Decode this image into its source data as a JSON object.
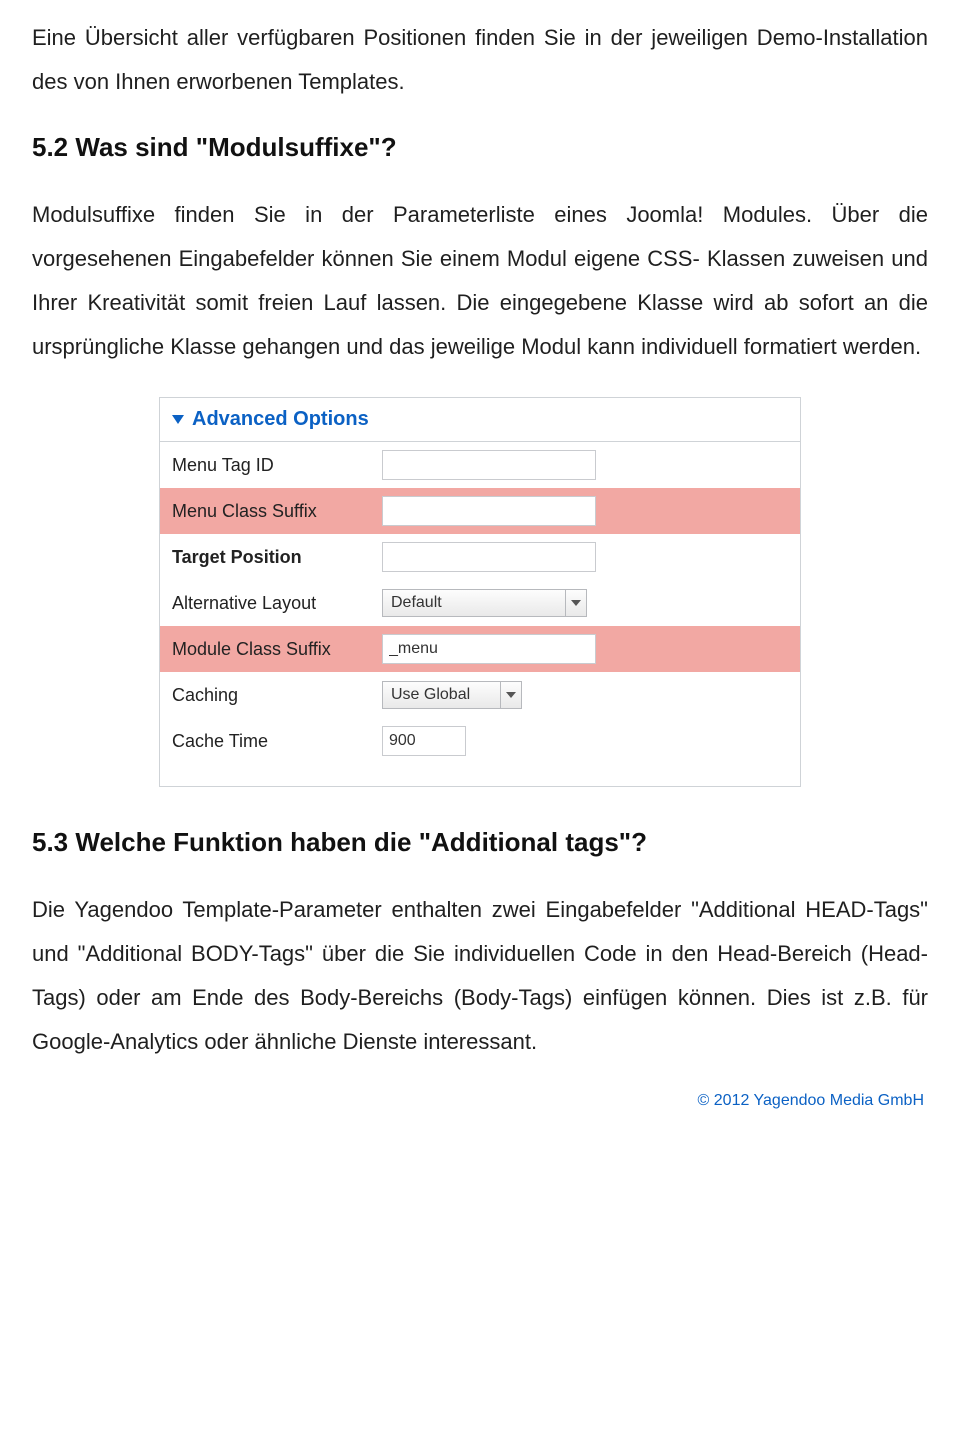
{
  "intro_paragraph": "Eine Übersicht aller verfügbaren Positionen finden Sie in der jeweiligen Demo-Installation des von Ihnen erworbenen Templates.",
  "heading_5_2": "5.2 Was sind \"Modulsuffixe\"?",
  "paragraph_5_2": "Modulsuffixe finden Sie in der Parameterliste eines Joomla! Modules. Über die vorgesehenen Eingabefelder können Sie einem Modul eigene CSS- Klassen zuweisen und Ihrer Kreativität somit freien Lauf lassen. Die eingegebene Klasse wird ab sofort an die  ursprüngliche Klasse gehangen und das jeweilige Modul kann individuell formatiert werden.",
  "panel": {
    "title": "Advanced Options",
    "rows": {
      "menu_tag_id": {
        "label": "Menu Tag ID",
        "value": ""
      },
      "menu_class_suffix": {
        "label": "Menu Class Suffix",
        "value": ""
      },
      "target_position": {
        "label": "Target Position",
        "value": ""
      },
      "alternative_layout": {
        "label": "Alternative Layout",
        "value": "Default"
      },
      "module_class_suffix": {
        "label": "Module Class Suffix",
        "value": "_menu"
      },
      "caching": {
        "label": "Caching",
        "value": "Use Global"
      },
      "cache_time": {
        "label": "Cache Time",
        "value": "900"
      }
    }
  },
  "heading_5_3": "5.3 Welche Funktion haben die \"Additional tags\"?",
  "paragraph_5_3": "Die Yagendoo Template-Parameter enthalten zwei Eingabefelder \"Additional HEAD-Tags\" und \"Additional BODY-Tags\" über die Sie individuellen Code in den Head-Bereich (Head-Tags) oder am  Ende  des Body-Bereichs (Body-Tags) einfügen können. Dies ist z.B. für Google-Analytics oder ähnliche Dienste interessant.",
  "footer": "© 2012 Yagendoo Media GmbH"
}
